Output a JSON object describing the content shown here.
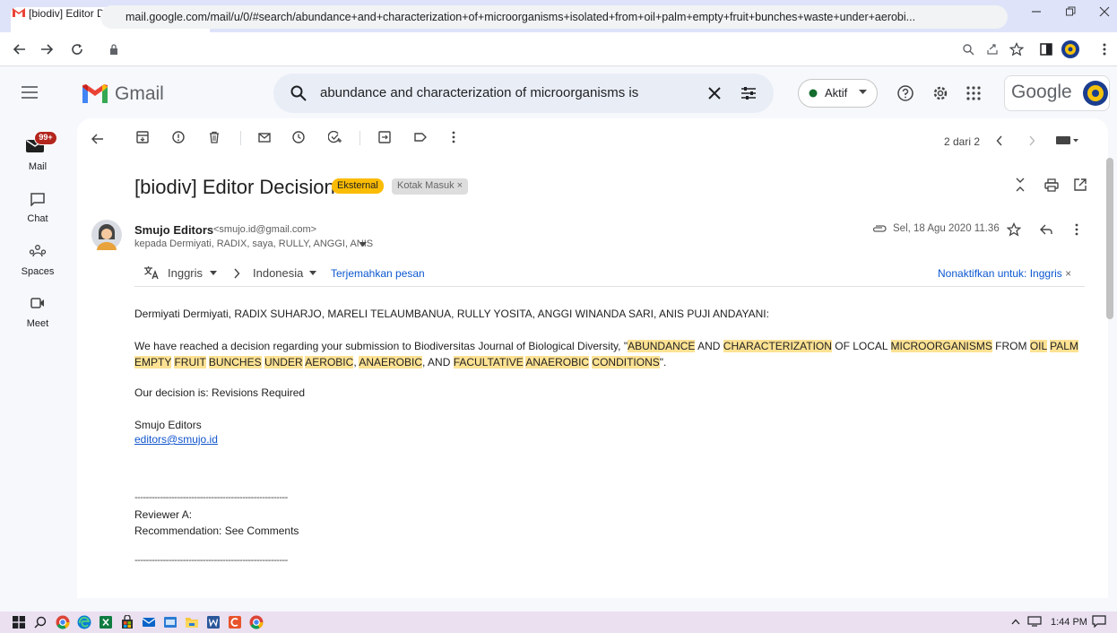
{
  "browser": {
    "tab_title": "[biodiv] Editor Decision - mareli.t",
    "tab_close": "×",
    "new_tab": "+",
    "url": "mail.google.com/mail/u/0/#search/abundance+and+characterization+of+microorganisms+isolated+from+oil+palm+empty+fruit+bunches+waste+under+aerobi..."
  },
  "gmail": {
    "brand": "Gmail",
    "search_value": "abundance and characterization of microorganisms isolated frc",
    "status_label": "Aktif",
    "account_brand": "Google",
    "unread_badge": "99+"
  },
  "rail": {
    "items": [
      {
        "label": "Mail",
        "icon": "mail-icon"
      },
      {
        "label": "Chat",
        "icon": "chat-icon"
      },
      {
        "label": "Spaces",
        "icon": "spaces-icon"
      },
      {
        "label": "Meet",
        "icon": "meet-icon"
      }
    ]
  },
  "toolbar": {
    "pager": "2 dari 2"
  },
  "email": {
    "subject": "[biodiv] Editor Decision",
    "label_external": "Eksternal",
    "label_inbox": "Kotak Masuk",
    "label_inbox_close": "×",
    "sender_name": "Smujo Editors",
    "sender_email": "<smujo.id@gmail.com>",
    "recipients": "kepada Dermiyati, RADIX, saya, RULLY, ANGGI, ANIS",
    "date": "Sel, 18 Agu 2020 11.36",
    "translate_from": "Inggris",
    "translate_to": "Indonesia",
    "translate_action": "Terjemahkan pesan",
    "translate_off": "Nonaktifkan untuk: Inggris",
    "translate_off_close": "×",
    "body": {
      "greeting": "Dermiyati Dermiyati, RADIX SUHARJO, MARELI TELAUMBANUA, RULLY YOSITA, ANGGI WINANDA SARI, ANIS PUJI ANDAYANI:",
      "p1_a": "We have reached a decision regarding your submission to Biodiversitas Journal of Biological Diversity, \"",
      "hl_abundance": "ABUNDANCE",
      "p1_and": " AND ",
      "hl_characterization": "CHARACTERIZATION",
      "p1_oflocal": " OF LOCAL ",
      "hl_microorganisms": "MICROORGANISMS",
      "p1_from": " FROM ",
      "hl_oil": "OIL",
      "p1_sp1": " ",
      "hl_palm": "PALM",
      "hl_empty": "EMPTY",
      "p1_sp2": " ",
      "hl_fruit": "FRUIT",
      "p1_sp3": " ",
      "hl_bunches": "BUNCHES",
      "p1_sp4": " ",
      "hl_under": "UNDER",
      "p1_sp5": " ",
      "hl_aerobic": "AEROBIC",
      "p1_comma": ", ",
      "hl_anaerobic1": "ANAEROBIC",
      "p1_and2": ", AND ",
      "hl_facultative": "FACULTATIVE",
      "p1_sp6": " ",
      "hl_anaerobic2": "ANAEROBIC",
      "p1_sp7": " ",
      "hl_conditions": "CONDITIONS",
      "p1_end": "\".",
      "decision": "Our decision is: Revisions Required",
      "sign_name": "Smujo Editors",
      "sign_email": "editors@smujo.id",
      "separator": "------------------------------------------------------",
      "reviewer": "Reviewer A:",
      "recommendation": "Recommendation: See Comments"
    }
  },
  "taskbar": {
    "time": "1:44 PM"
  },
  "colors": {
    "accent": "#0b57d0",
    "highlight": "#fde293",
    "external_chip": "#fbbc04",
    "badge": "#b3261e"
  }
}
